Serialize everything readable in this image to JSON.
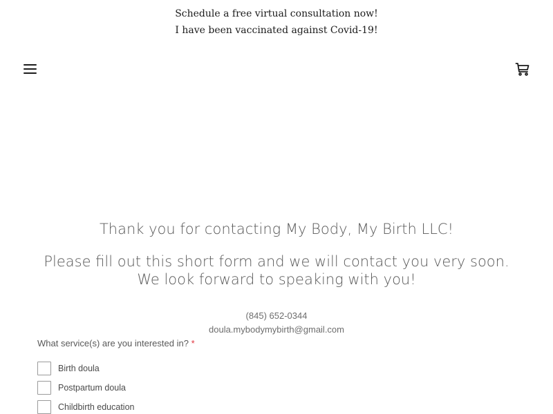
{
  "announcement": {
    "line1": "Schedule a free virtual consultation now!",
    "line2": "I have been vaccinated against Covid-19!"
  },
  "header": {
    "menu_icon": "hamburger-menu-icon",
    "cart_icon": "shopping-cart-icon"
  },
  "main": {
    "thank_you": "Thank you for contacting My Body, My Birth LLC!",
    "instructions": "Please fill out this short form and we will contact you very soon. We look forward to speaking with you!",
    "phone": "(845) 652-0344",
    "email": "doula.mybodymybirth@gmail.com"
  },
  "form": {
    "question": "What service(s) are you interested in?",
    "required_marker": "*",
    "options": [
      "Birth doula",
      "Postpartum doula",
      "Childbirth education"
    ]
  },
  "colors": {
    "text": "#1b1b1b",
    "muted": "#595959",
    "required": "#e0343d"
  }
}
